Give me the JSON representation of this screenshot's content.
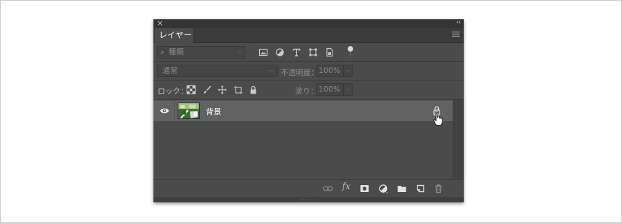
{
  "panel": {
    "tab_label": "レイヤー",
    "close_glyph": "×",
    "collapse_glyph": "‹‹"
  },
  "filter": {
    "kind_label": "種類",
    "icons": [
      "image-filter-icon",
      "adjustment-filter-icon",
      "type-filter-icon",
      "shape-filter-icon",
      "smart-object-filter-icon",
      "filter-toggle-icon"
    ]
  },
  "blend": {
    "mode": "通常",
    "opacity_label": "不透明度：",
    "opacity_value": "100%"
  },
  "lock": {
    "label": "ロック：",
    "icons": [
      "lock-transparent-pixels-icon",
      "lock-image-pixels-icon",
      "lock-position-icon",
      "lock-artboard-icon",
      "lock-all-icon"
    ],
    "fill_label": "塗り：",
    "fill_value": "100%"
  },
  "layers": [
    {
      "name": "背景",
      "visible": true,
      "locked": true
    }
  ],
  "footer": {
    "icons": [
      "link-layers-icon",
      "fx-icon",
      "add-mask-icon",
      "adjustment-layer-icon",
      "new-group-icon",
      "new-layer-icon",
      "delete-icon"
    ],
    "fx_label": "fx"
  },
  "colors": {
    "panel_bg": "#4b4b4b",
    "selected_row": "#626262",
    "text": "#d6d6d6"
  }
}
